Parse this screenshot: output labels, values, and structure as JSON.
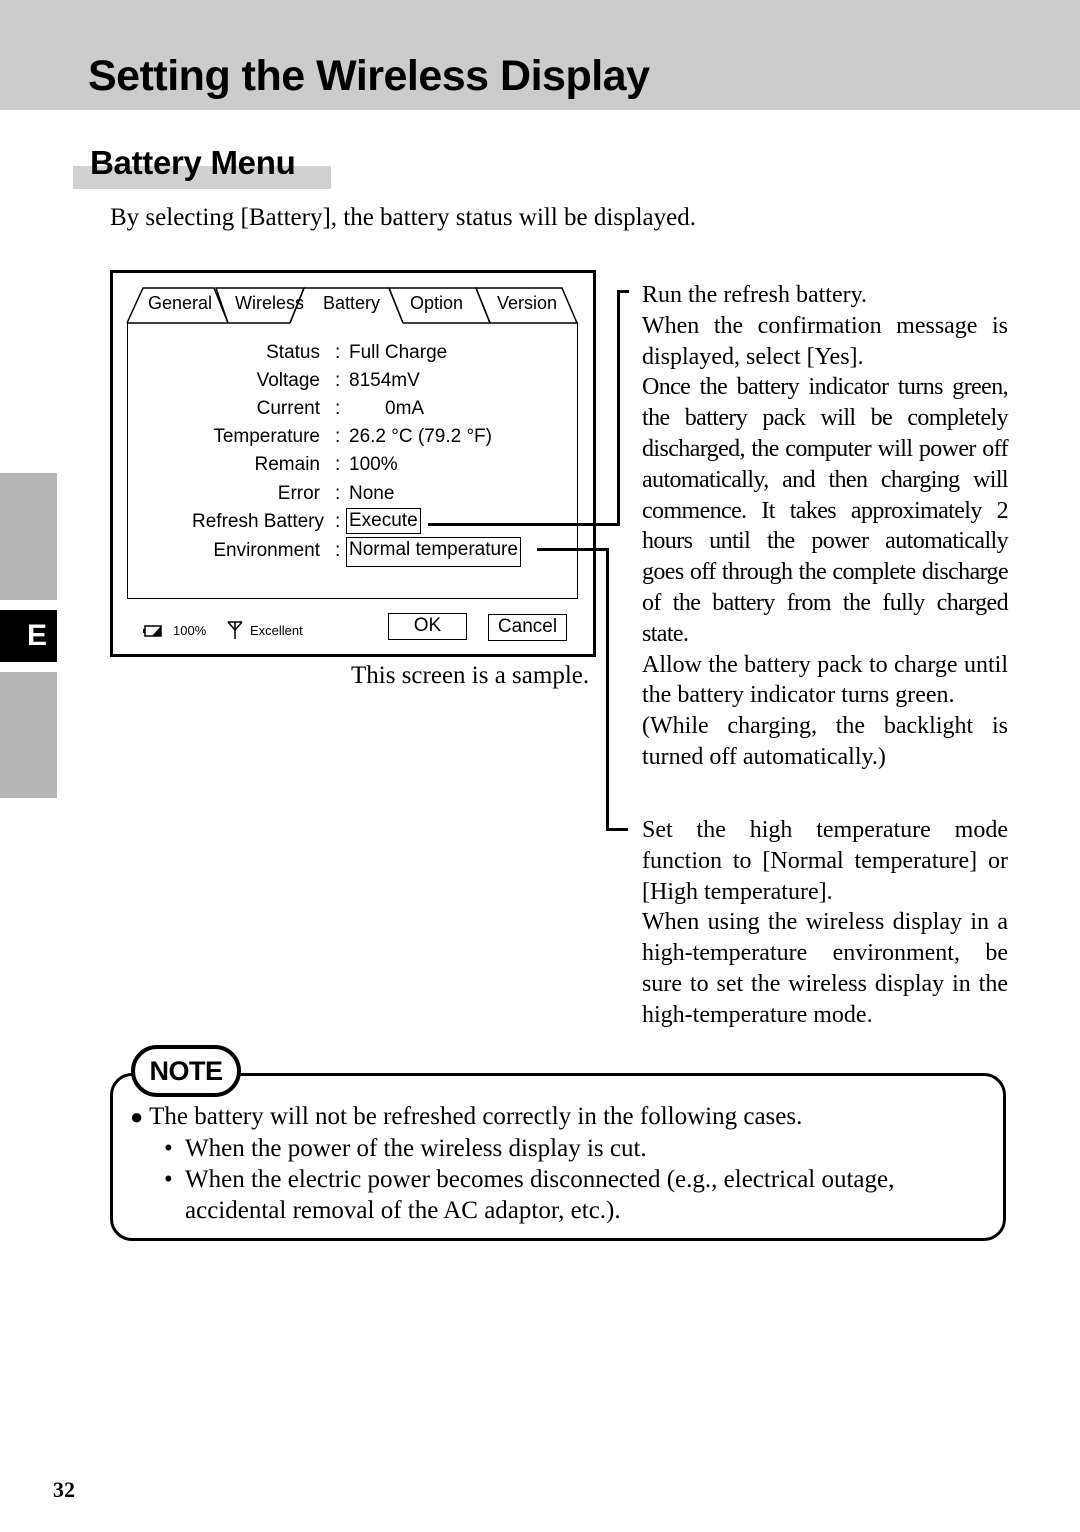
{
  "header": {
    "title": "Setting the Wireless Display"
  },
  "section": {
    "title": "Battery Menu",
    "intro": "By selecting [Battery], the battery status will be displayed."
  },
  "side_index": {
    "current_letter": "E"
  },
  "dialog": {
    "tabs": [
      {
        "label": "General",
        "active": false
      },
      {
        "label": "Wireless",
        "active": false
      },
      {
        "label": "Battery",
        "active": true
      },
      {
        "label": "Option",
        "active": false
      },
      {
        "label": "Version",
        "active": false
      }
    ],
    "rows": [
      {
        "label": "Status",
        "value": "Full Charge"
      },
      {
        "label": "Voltage",
        "value": "8154mV"
      },
      {
        "label": "Current",
        "value": "0mA"
      },
      {
        "label": "Temperature",
        "value": "26.2 °C (79.2 °F)"
      },
      {
        "label": "Remain",
        "value": "100%"
      },
      {
        "label": "Error",
        "value": "None"
      },
      {
        "label": "Refresh Battery",
        "value": "Execute"
      },
      {
        "label": "Environment",
        "value": "Normal temperature"
      }
    ],
    "colon": ":",
    "status_bar": {
      "battery_icon": "battery-icon",
      "battery_level": "100%",
      "signal_icon": "antenna-icon",
      "signal_quality": "Excellent"
    },
    "buttons": {
      "ok": "OK",
      "cancel": "Cancel"
    },
    "caption": "This screen is a sample."
  },
  "annotations": {
    "refresh_battery": [
      "Run the refresh battery.",
      "When the confirmation message is displayed, select [Yes].",
      "Once the battery indicator turns green, the battery pack will be completely discharged, the computer will power off automatically, and then charging will commence. It takes approximately 2 hours until the power automatically goes off through the complete discharge of the battery from the fully charged state.",
      "Allow the battery pack to charge until the battery indicator turns green.",
      "(While charging, the backlight is turned off automatically.)"
    ],
    "environment": [
      "Set the high temperature mode function to [Normal temperature] or [High temperature].",
      "When using the wireless display in a high-temperature environment, be sure to set the wireless display in the high-temperature mode."
    ]
  },
  "note": {
    "badge": "NOTE",
    "bullet": "●",
    "main": "The battery will not be refreshed correctly in the following cases.",
    "sub_bullet": "•",
    "items": [
      "When the power of the wireless display is cut.",
      "When the electric power becomes disconnected (e.g., electrical outage, accidental removal of the AC adaptor, etc.)."
    ]
  },
  "footer": {
    "page_number": "32"
  }
}
